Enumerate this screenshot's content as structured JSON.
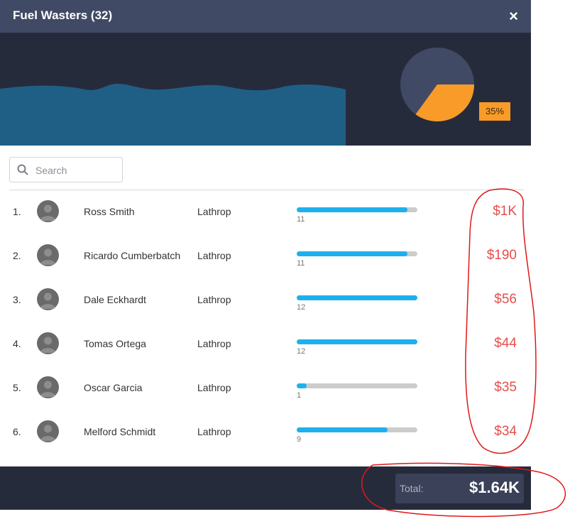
{
  "modal": {
    "title": "Fuel Wasters (32)",
    "close_icon": "×"
  },
  "hero": {
    "pie_percent_label": "35%",
    "pie_value": 0.35,
    "colors": {
      "pie_main": "#404a64",
      "pie_slice": "#f89b28",
      "wave": "#1f5f86"
    }
  },
  "search": {
    "placeholder": "Search",
    "value": ""
  },
  "rows": [
    {
      "rank": "1.",
      "name": "Ross Smith",
      "location": "Lathrop",
      "count": "11",
      "bar": 0.92,
      "amount": "$1K"
    },
    {
      "rank": "2.",
      "name": "Ricardo Cumberbatch",
      "location": "Lathrop",
      "count": "11",
      "bar": 0.92,
      "amount": "$190"
    },
    {
      "rank": "3.",
      "name": "Dale Eckhardt",
      "location": "Lathrop",
      "count": "12",
      "bar": 1.0,
      "amount": "$56"
    },
    {
      "rank": "4.",
      "name": "Tomas Ortega",
      "location": "Lathrop",
      "count": "12",
      "bar": 1.0,
      "amount": "$44"
    },
    {
      "rank": "5.",
      "name": "Oscar Garcia",
      "location": "Lathrop",
      "count": "1",
      "bar": 0.08,
      "amount": "$35"
    },
    {
      "rank": "6.",
      "name": "Melford Schmidt",
      "location": "Lathrop",
      "count": "9",
      "bar": 0.75,
      "amount": "$34"
    }
  ],
  "footer": {
    "total_label": "Total:",
    "total_value": "$1.64K"
  }
}
